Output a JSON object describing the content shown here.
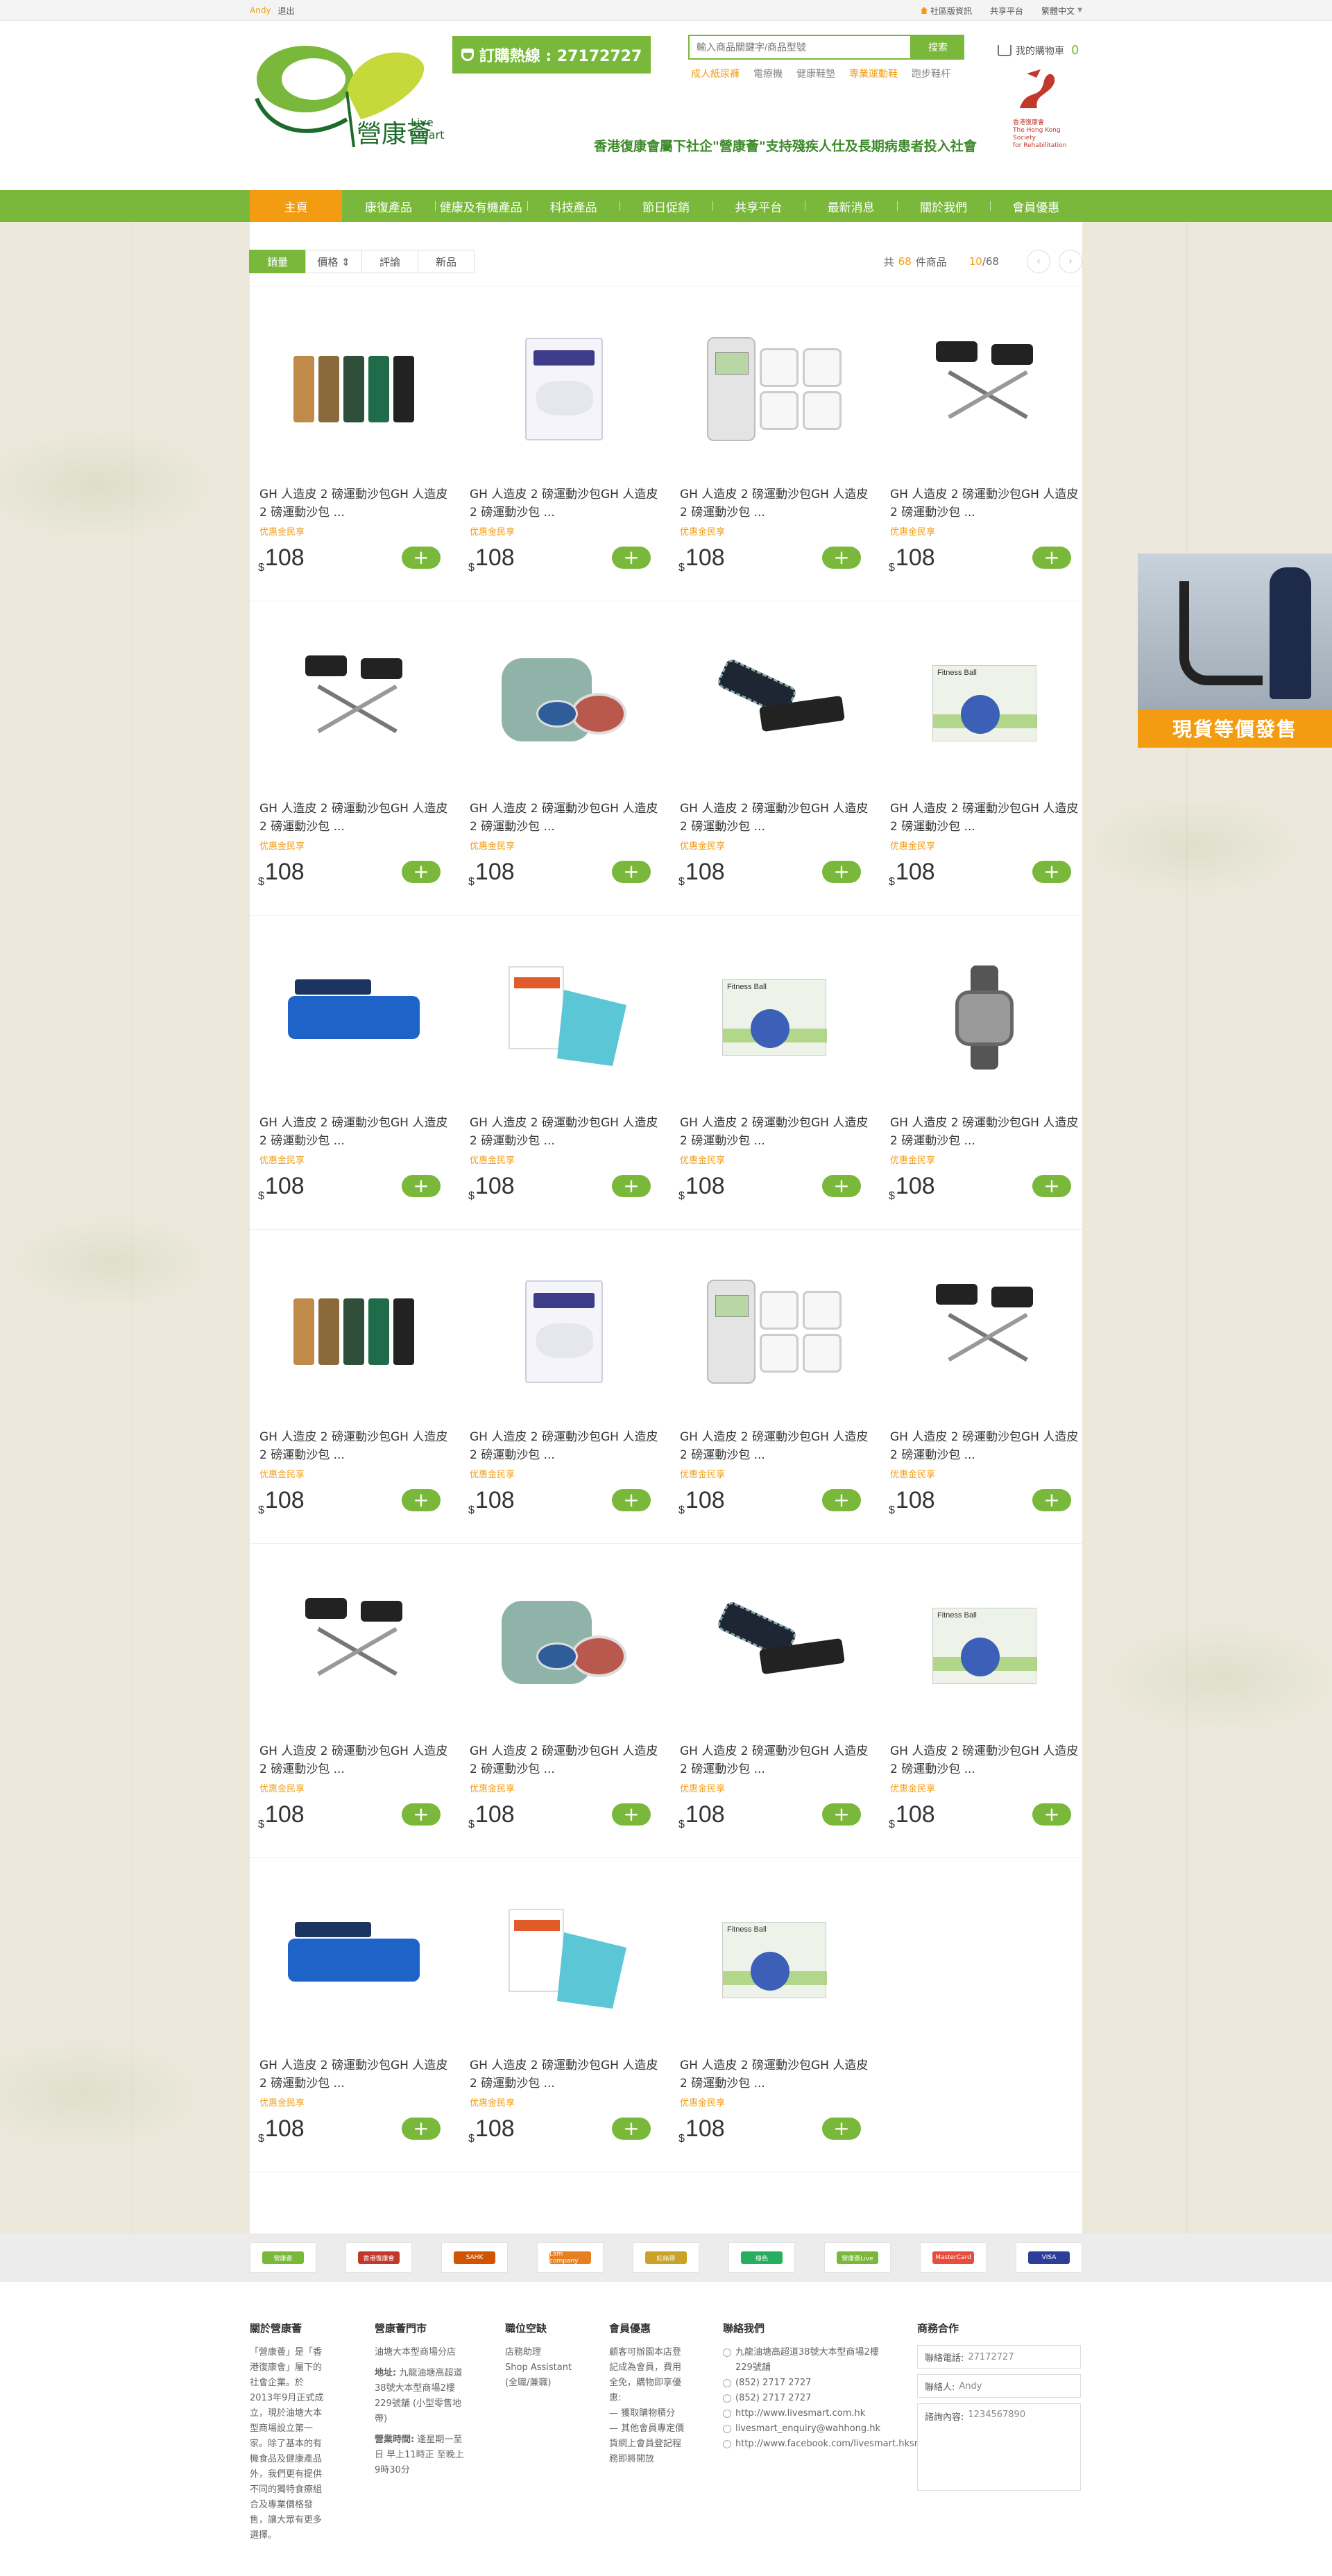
{
  "topbar": {
    "user": "Andy",
    "logout": "退出",
    "links": [
      "社區版資訊",
      "共享平台",
      "繁體中文"
    ]
  },
  "header": {
    "logo_text": "營康薈",
    "logo_en": "Live Smart",
    "hotline": "訂購熱線 : 27172727",
    "search_placeholder": "輸入商品關鍵字/商品型號",
    "search_button": "搜索",
    "hot_words": [
      "成人紙尿褲",
      "電療機",
      "健康鞋墊",
      "專業運動鞋",
      "跑步鞋杆"
    ],
    "cart_label": "我的購物車",
    "cart_count": "0",
    "slogan": "香港復康會屬下社企\"營康薈\"支持殘疾人仕及長期病患者投入社會",
    "partner_cn": "香港復康會",
    "partner_en1": "The Hong Kong Society",
    "partner_en2": "for Rehabilitation"
  },
  "nav": [
    "主頁",
    "康復產品",
    "健康及有機產品",
    "科技產品",
    "節日促銷",
    "共享平台",
    "最新消息",
    "關於我們",
    "會員優惠"
  ],
  "sort": {
    "tabs": [
      "銷量",
      "價格 ⇕",
      "評論",
      "新品"
    ],
    "count_prefix": "共",
    "count": "68",
    "count_suffix": "件商品",
    "page_current": "10",
    "page_total": "/68",
    "prev": "‹",
    "next": "›"
  },
  "product_name": "GH 人造皮 2 磅運動沙包GH 人造皮 2 磅運動沙包 ...",
  "product_name_alt": "GH 人造皮 2 磅運動沙包GH 人造皮 2 磅運動沙包 ...",
  "promo": "优惠金民享",
  "currency": "$",
  "price": "108",
  "add": "+",
  "products": [
    {
      "img": "resistance-bands",
      "color": "#c08a4a"
    },
    {
      "img": "adult-diaper-pack",
      "color": "#3c3c8a"
    },
    {
      "img": "tens-device",
      "color": "#b9d7a4"
    },
    {
      "img": "pedal-exerciser",
      "color": "#222"
    },
    {
      "img": "pedal-exerciser",
      "color": "#222"
    },
    {
      "img": "therapy-putty",
      "color": "#8fb3a8"
    },
    {
      "img": "ankle-strap",
      "color": "#1f2633"
    },
    {
      "img": "fitness-ball",
      "color": "#3c5fb8"
    },
    {
      "img": "foam-roller",
      "color": "#1e64c8"
    },
    {
      "img": "kinesiology-tape",
      "color": "#5bc7d6"
    },
    {
      "img": "fitness-ball",
      "color": "#3c5fb8"
    },
    {
      "img": "heart-rate-watch",
      "color": "#666"
    },
    {
      "img": "resistance-bands",
      "color": "#c08a4a"
    },
    {
      "img": "adult-diaper-pack",
      "color": "#3c3c8a"
    },
    {
      "img": "tens-device",
      "color": "#b9d7a4"
    },
    {
      "img": "pedal-exerciser",
      "color": "#222"
    },
    {
      "img": "pedal-exerciser",
      "color": "#222"
    },
    {
      "img": "therapy-putty",
      "color": "#8fb3a8"
    },
    {
      "img": "ankle-strap",
      "color": "#1f2633"
    },
    {
      "img": "fitness-ball",
      "color": "#3c5fb8"
    },
    {
      "img": "foam-roller",
      "color": "#1e64c8"
    },
    {
      "img": "kinesiology-tape",
      "color": "#5bc7d6"
    },
    {
      "img": "fitness-ball",
      "color": "#3c5fb8"
    }
  ],
  "float_ad": "現貨等價發售",
  "partner_logos": [
    "營康薈",
    "香港復康會",
    "SAHK",
    "Lam company",
    "紅絲帶",
    "綠色",
    "營康薈Live",
    "MasterCard",
    "VISA"
  ],
  "footer": {
    "about_title": "關於營康薈",
    "about_text": "「營康薈」是「香港復康會」屬下的社會企業。於2013年9月正式成立，現於油塘大本型商場設立第一家。除了基本的有機食品及健康產品外，我們更有提供不同的獨特食療組合及專業價格發售，讓大眾有更多選擇。",
    "shop_title": "營康薈門市",
    "shop_name": "油塘大本型商場分店",
    "shop_addr_label": "地址:",
    "shop_addr": "九龍油塘高超道38號大本型商場2樓229號舖 (小型零售地帶)",
    "shop_hours_label": "營業時間:",
    "shop_hours": "逢星期一至日 早上11時正 至晚上 9時30分",
    "jobs_title": "職位空缺",
    "jobs_1": "店務助理",
    "jobs_2": "Shop Assistant",
    "jobs_3": "(全職/兼職)",
    "member_title": "會員優惠",
    "member_text": "顧客可辦園本店登記成為會員，費用全免，購物即享優惠:",
    "member_1": "— 獲取購物積分",
    "member_2": "— 其他會員專定價貨網上會員登記程務即將開放",
    "contact_title": "聯絡我們",
    "contact_addr": "九龍油塘高超道38號大本型商場2樓229號舖",
    "contact_tel": "(852) 2717  2727",
    "contact_fax": "(852) 2717  2727",
    "contact_web": "http://www.livesmart.com.hk",
    "contact_email": "livesmart_enquiry@wahhong.hk",
    "contact_fb": "http://www.facebook.com/livesmart.hksr",
    "biz_title": "商務合作",
    "biz_phone_label": "聯絡電話:",
    "biz_phone": "27172727",
    "biz_name_label": "聯絡人:",
    "biz_name": "Andy",
    "biz_msg_label": "諮詢內容:",
    "biz_msg": "1234567890"
  }
}
